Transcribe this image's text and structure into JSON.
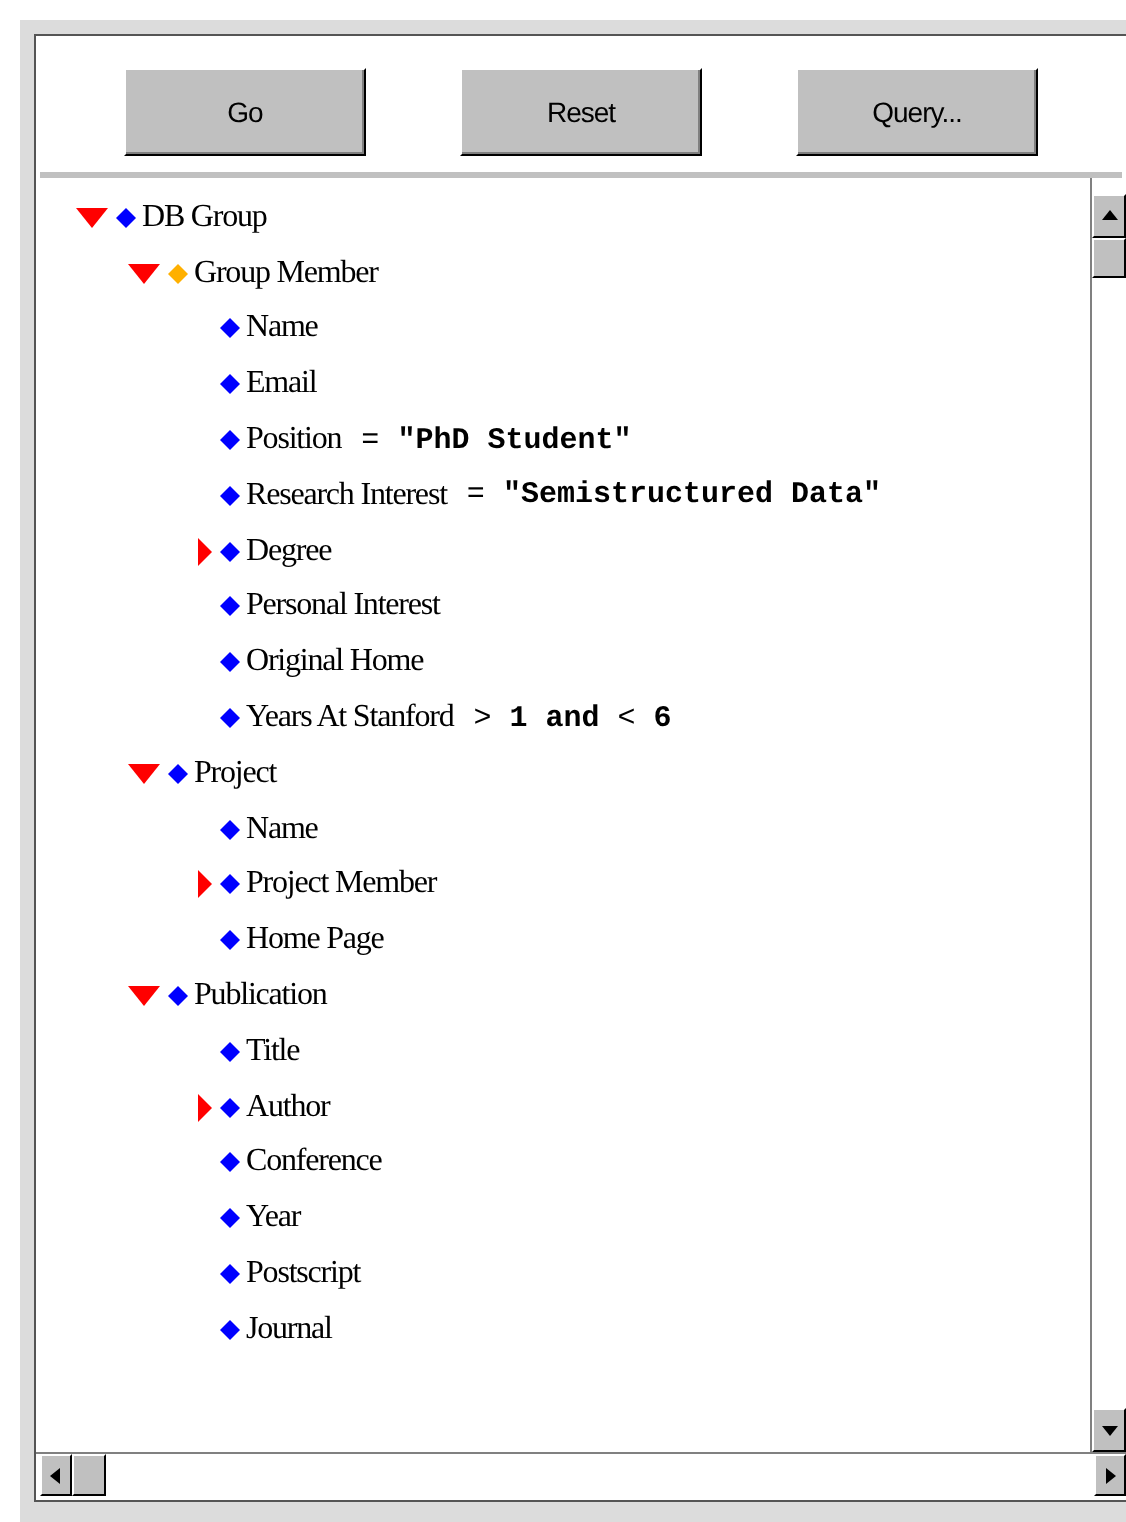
{
  "toolbar": {
    "buttons": [
      "Go",
      "Reset",
      "Query..."
    ]
  },
  "tree": [
    {
      "label": "DB Group",
      "color": "#0000ff",
      "expanded": true,
      "children": [
        {
          "label": "Group Member",
          "color": "#ffb000",
          "expanded": true,
          "children": [
            {
              "label": "Name",
              "color": "#0000ff"
            },
            {
              "label": "Email",
              "color": "#0000ff"
            },
            {
              "label": "Position",
              "color": "#0000ff",
              "condition": "= **\"PhD Student\"**"
            },
            {
              "label": "Research Interest",
              "color": "#0000ff",
              "condition": "= **\"Semistructured Data\"**"
            },
            {
              "label": "Degree",
              "color": "#0000ff",
              "expanded": false
            },
            {
              "label": "Personal Interest",
              "color": "#0000ff"
            },
            {
              "label": "Original Home",
              "color": "#0000ff"
            },
            {
              "label": "Years At Stanford",
              "color": "#0000ff",
              "condition": "> **1 and** < **6**"
            }
          ]
        },
        {
          "label": "Project",
          "color": "#0000ff",
          "expanded": true,
          "children": [
            {
              "label": "Name",
              "color": "#0000ff"
            },
            {
              "label": "Project Member",
              "color": "#0000ff",
              "expanded": false
            },
            {
              "label": "Home Page",
              "color": "#0000ff"
            }
          ]
        },
        {
          "label": "Publication",
          "color": "#0000ff",
          "expanded": true,
          "children": [
            {
              "label": "Title",
              "color": "#0000ff"
            },
            {
              "label": "Author",
              "color": "#0000ff",
              "expanded": false
            },
            {
              "label": "Conference",
              "color": "#0000ff"
            },
            {
              "label": "Year",
              "color": "#0000ff"
            },
            {
              "label": "Postscript",
              "color": "#0000ff"
            },
            {
              "label": "Journal",
              "color": "#0000ff"
            }
          ]
        }
      ]
    }
  ]
}
